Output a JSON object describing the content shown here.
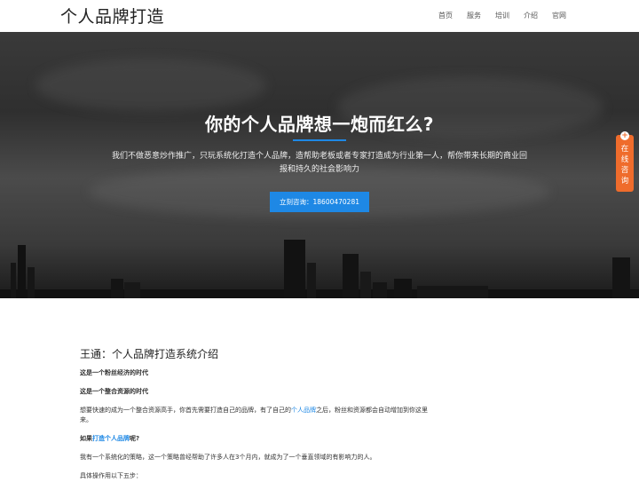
{
  "header": {
    "logo": "个人品牌打造",
    "nav": [
      "首页",
      "服务",
      "培训",
      "介绍",
      "官网"
    ]
  },
  "hero": {
    "title": "你的个人品牌想一炮而红么?",
    "subtitle": "我们不做恶意炒作推广，只玩系统化打造个人品牌，造帮助老板或者专家打造成为行业第一人，帮你带来长期的商业回报和持久的社会影响力",
    "button": "立刻咨询：18600470281"
  },
  "float_consult": {
    "plus": "+",
    "text": "在线咨询"
  },
  "content": {
    "heading": "王通：个人品牌打造系统介绍",
    "line1": "这是一个粉丝经济的时代",
    "line2": "这是一个整合资源的时代",
    "para1_pre": "想要快速的成为一个整合资源高手，你首先需要打造自己的品牌，有了自己的",
    "para1_link": "个人品牌",
    "para1_post": "之后，粉丝和资源都会自动增加到你这里来。",
    "q_pre": "如果",
    "q_link": "打造个人品牌",
    "q_post": "呢?",
    "para2": "我有一个系统化的策略，这一个策略曾经帮助了许多人在3个月内，就成为了一个垂直领域的有影响力的人。",
    "para3": "具体操作用以下五步："
  },
  "colors": {
    "accent": "#1e88e5",
    "consult": "#ef6c2c"
  }
}
